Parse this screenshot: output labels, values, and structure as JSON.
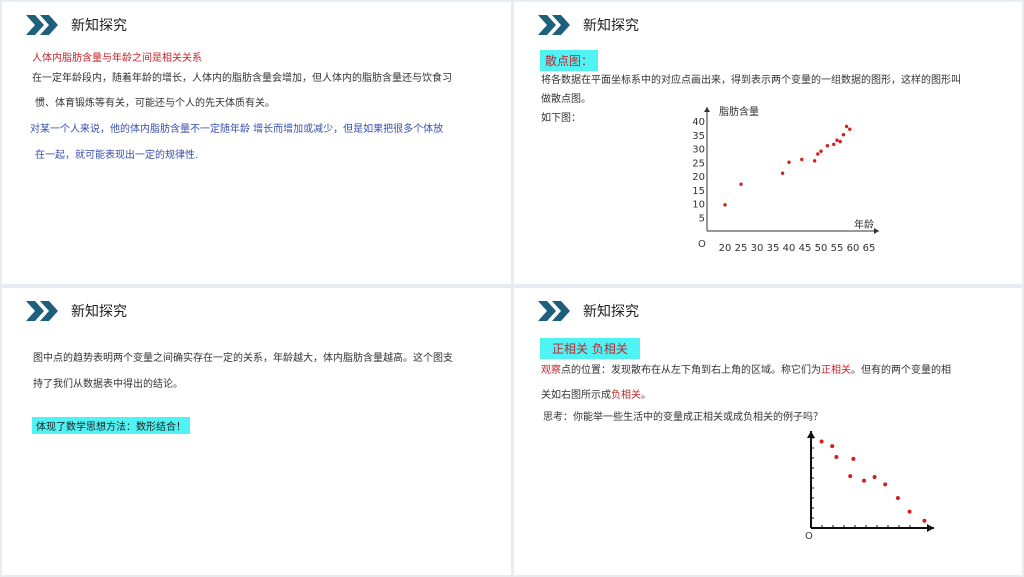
{
  "colors": {
    "accent_chevron": "#1e5f7c",
    "highlight": "#4ff3f3",
    "red_text": "#c0262d",
    "blue_text": "#3a4fae",
    "dot": "#d3201c"
  },
  "panel1": {
    "title": "新知探究",
    "subtitle": "人体内脂肪含量与年龄之间是相关关系",
    "para1_line1": "在一定年龄段内，随着年龄的增长，人体内的脂肪含量会增加，但人体内的脂肪含量还与饮食习",
    "para1_line2": "惯、体育锻炼等有关，可能还与个人的先天体质有关。",
    "para2_line1": "对某一个人来说，他的体内脂肪含量不一定随年龄    增长而增加或减少，但是如果把很多个体放",
    "para2_line2": "在一起，就可能表现出一定的规律性."
  },
  "panel2": {
    "title": "新知探究",
    "badge": "散点图：",
    "line1": "将各数据在平面坐标系中的对应点画出来，得到表示两个变量的一组数据的图形，这样的图形叫",
    "line2": "做散点图。",
    "line3": "如下图："
  },
  "panel3": {
    "title": "新知探究",
    "line1": "图中点的趋势表明两个变量之间确实存在一定的关系，年龄越大，体内脂肪含量越高。这个图支",
    "line2": "持了我们从数据表中得出的结论。",
    "badge": "体现了数学思想方法：数形结合！"
  },
  "panel4": {
    "title": "新知探究",
    "badge": "正相关  负相关",
    "line1_a": "观察",
    "line1_b": "点的位置：发现散布在从左下角到右上角的区域。称它们为",
    "line1_c": "正相关",
    "line1_d": "。但有的两个变量的相",
    "line2_a": "关如右图所示成",
    "line2_b": "负相关",
    "line2_c": "。",
    "line3": "思考：你能举一些生活中的变量成正相关或成负相关的例子吗？"
  },
  "chart_data": [
    {
      "type": "scatter",
      "title": "",
      "xlabel": "年龄",
      "ylabel": "脂肪含量",
      "origin_label": "O",
      "xlim": [
        15,
        65
      ],
      "ylim": [
        0,
        40
      ],
      "x_ticks": [
        "20",
        "25",
        "30",
        "35",
        "40",
        "45",
        "50",
        "55",
        "60",
        "65"
      ],
      "y_ticks": [
        "5",
        "10",
        "15",
        "20",
        "25",
        "30",
        "35",
        "40"
      ],
      "points": [
        [
          20,
          9.5
        ],
        [
          25,
          17
        ],
        [
          38,
          21
        ],
        [
          40,
          25
        ],
        [
          44,
          26
        ],
        [
          48,
          25.5
        ],
        [
          49,
          28
        ],
        [
          50,
          29
        ],
        [
          52,
          31
        ],
        [
          54,
          31.5
        ],
        [
          55,
          33
        ],
        [
          56,
          32.5
        ],
        [
          57,
          35
        ],
        [
          58,
          38
        ],
        [
          59,
          37
        ]
      ]
    },
    {
      "type": "scatter",
      "title": "",
      "xlabel": "",
      "ylabel": "",
      "origin_label": "O",
      "xlim": [
        0,
        10
      ],
      "ylim": [
        0,
        10
      ],
      "points": [
        [
          1,
          9.5
        ],
        [
          2,
          9
        ],
        [
          2.4,
          7.8
        ],
        [
          4,
          7.6
        ],
        [
          3.7,
          5.7
        ],
        [
          5,
          5.2
        ],
        [
          6,
          5.6
        ],
        [
          7,
          4.8
        ],
        [
          8.2,
          3.3
        ],
        [
          9.3,
          1.8
        ],
        [
          10.7,
          0.8
        ]
      ]
    }
  ]
}
